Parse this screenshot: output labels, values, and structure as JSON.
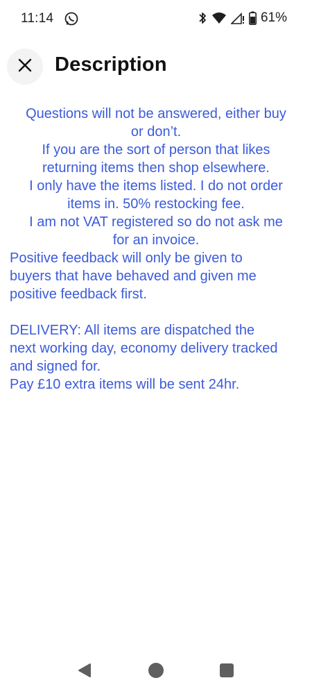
{
  "status_bar": {
    "time": "11:14",
    "battery": "61%",
    "icons": [
      "whatsapp-icon",
      "bluetooth-icon",
      "wifi-icon",
      "signal-icon",
      "battery-icon"
    ]
  },
  "header": {
    "close_icon": "close-icon",
    "title": "Description"
  },
  "description": {
    "color": "#3b5bdb",
    "lines": [
      "Questions will not be answered, either buy",
      "or don’t.",
      "If you are the sort of person that likes",
      "returning items then shop elsewhere.",
      "I only have the items listed. I do not order",
      "items in. 50% restocking fee.",
      "I am not VAT registered so do not ask me",
      "for an invoice.",
      "Positive feedback will only be given to",
      "buyers that have behaved and given me",
      "positive feedback first.",
      "DELIVERY: All items are dispatched the",
      "next working day, economy delivery tracked",
      "and signed for.",
      "Pay £10 extra items will be sent 24hr."
    ]
  },
  "nav_bar": {
    "icons": [
      "back-icon",
      "home-icon",
      "recents-icon"
    ]
  }
}
